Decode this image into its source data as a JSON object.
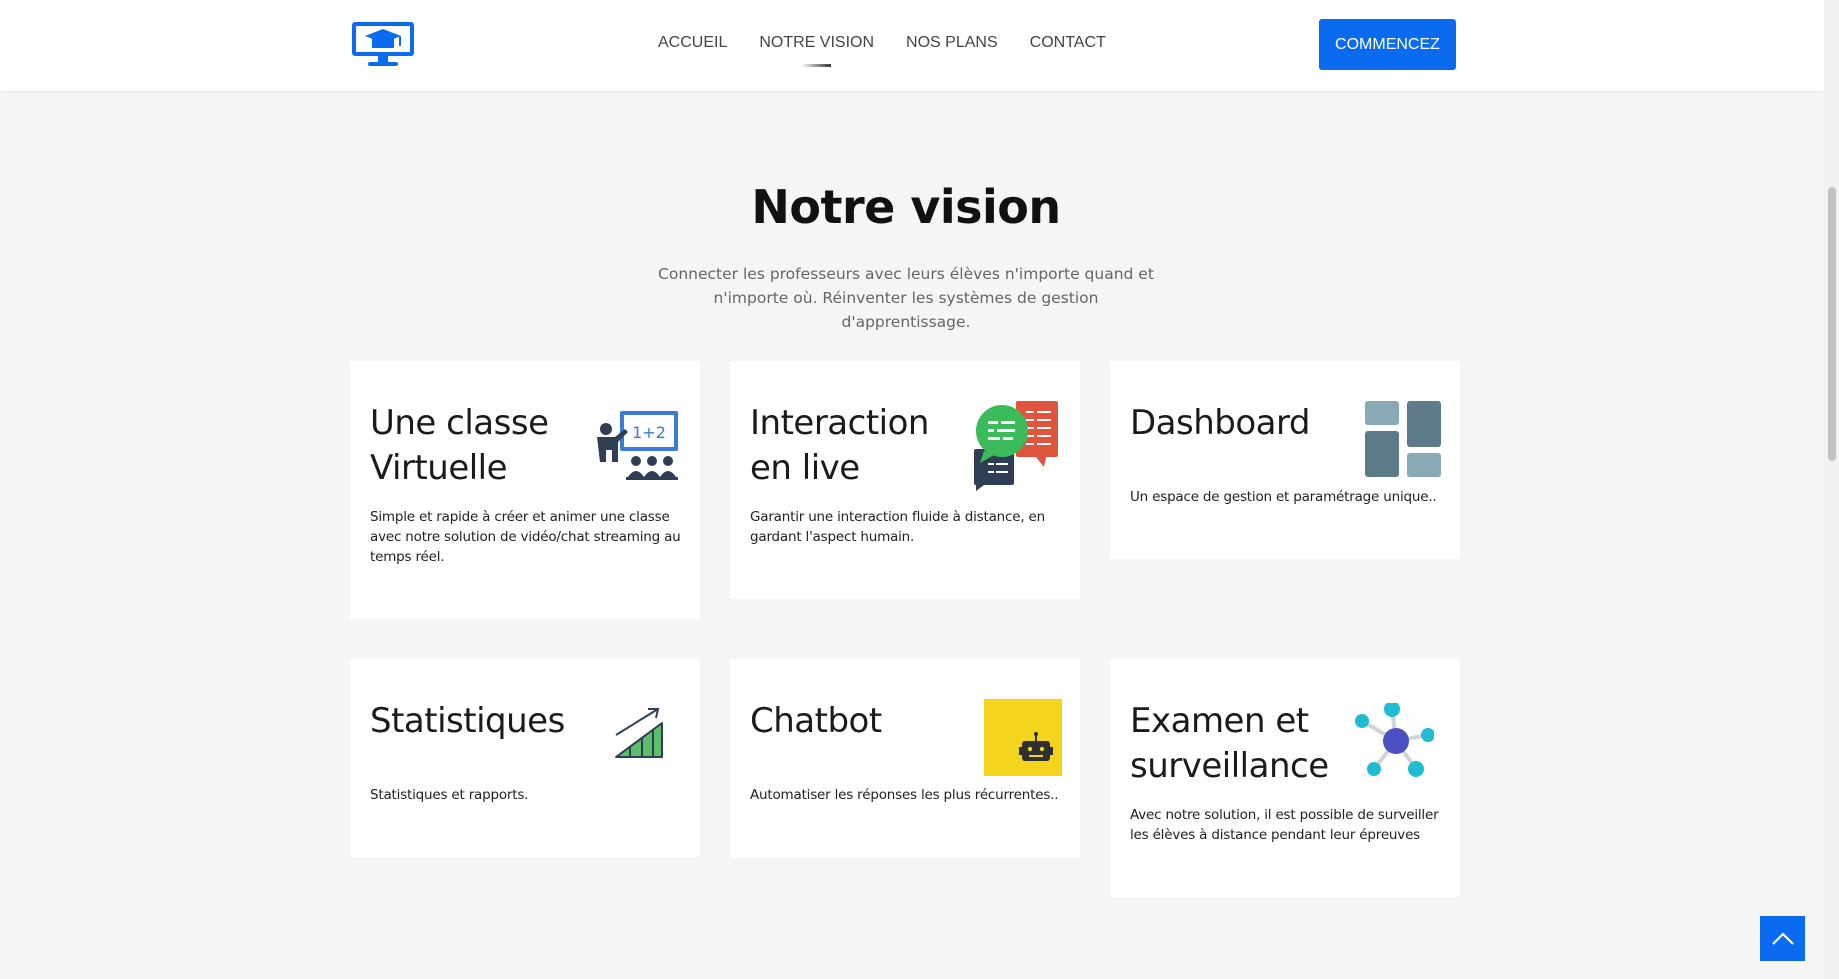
{
  "nav": {
    "items": [
      {
        "label": "ACCUEIL"
      },
      {
        "label": "NOTRE VISION"
      },
      {
        "label": "NOS PLANS"
      },
      {
        "label": "CONTACT"
      }
    ],
    "active_index": 1,
    "cta_label": "COMMENCEZ"
  },
  "hero": {
    "title": "Notre vision",
    "subtitle": "Connecter les professeurs avec leurs élèves n'importe quand et n'importe où. Réinventer les systèmes de gestion d'apprentissage."
  },
  "cards": [
    {
      "title": "Une classe Virtuelle",
      "desc": "Simple et rapide à créer et animer une classe avec notre solution de vidéo/chat streaming au temps réel.",
      "icon": "teacher-whiteboard-icon"
    },
    {
      "title": "Interaction en live",
      "desc": "Garantir une interaction fluide à distance, en gardant l'aspect humain.",
      "icon": "chat-bubbles-icon"
    },
    {
      "title": "Dashboard",
      "desc": "Un espace de gestion et paramétrage unique..",
      "icon": "dashboard-tiles-icon"
    },
    {
      "title": "Statistiques",
      "desc": "Statistiques et rapports.",
      "icon": "growth-chart-icon"
    },
    {
      "title": "Chatbot",
      "desc": "Automatiser les réponses les plus récurrentes..",
      "icon": "robot-icon"
    },
    {
      "title": "Examen et surveillance",
      "desc": "Avec notre solution, il est possible de surveiller les élèves à distance pendant leur épreuves",
      "icon": "network-nodes-icon"
    }
  ],
  "colors": {
    "accent": "#0a6bf0",
    "background": "#f5f5f5",
    "card": "#ffffff"
  }
}
